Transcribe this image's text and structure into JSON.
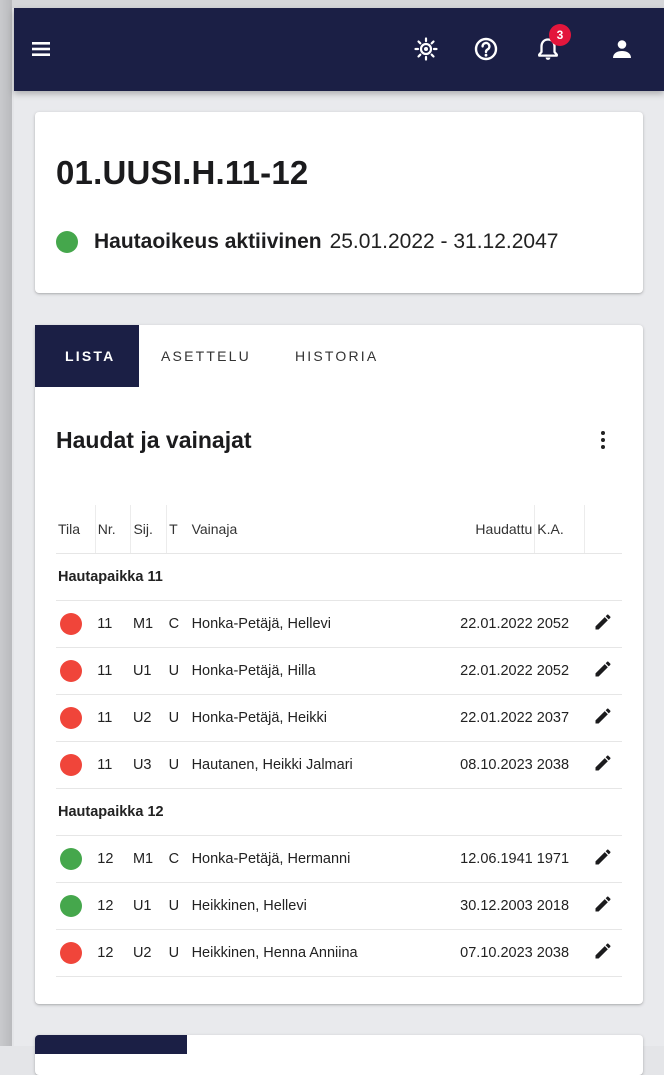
{
  "header": {
    "notification_count": "3",
    "icons": [
      "menu-icon",
      "sun-icon",
      "help-icon",
      "bell-icon",
      "user-icon"
    ]
  },
  "plot": {
    "id": "01.UUSI.H.11-12",
    "status_label": "Hautaoikeus aktiivinen",
    "status_dates": "25.01.2022 - 31.12.2047",
    "status_color": "#45a74c"
  },
  "tabs": [
    {
      "label": "LISTA",
      "active": true
    },
    {
      "label": "ASETTELU",
      "active": false
    },
    {
      "label": "HISTORIA",
      "active": false
    }
  ],
  "section": {
    "title": "Haudat ja vainajat"
  },
  "table": {
    "columns": [
      "Tila",
      "Nr.",
      "Sij.",
      "T",
      "Vainaja",
      "Haudattu",
      "K.A."
    ],
    "groups": [
      {
        "name": "Hautapaikka 11",
        "rows": [
          {
            "status": "red",
            "nr": "11",
            "sij": "M1",
            "t": "C",
            "name": "Honka-Petäjä, Hellevi",
            "date": "22.01.2022",
            "ka": "2052"
          },
          {
            "status": "red",
            "nr": "11",
            "sij": "U1",
            "t": "U",
            "name": "Honka-Petäjä, Hilla",
            "date": "22.01.2022",
            "ka": "2052"
          },
          {
            "status": "red",
            "nr": "11",
            "sij": "U2",
            "t": "U",
            "name": "Honka-Petäjä, Heikki",
            "date": "22.01.2022",
            "ka": "2037"
          },
          {
            "status": "red",
            "nr": "11",
            "sij": "U3",
            "t": "U",
            "name": "Hautanen, Heikki Jalmari",
            "date": "08.10.2023",
            "ka": "2038"
          }
        ]
      },
      {
        "name": "Hautapaikka 12",
        "rows": [
          {
            "status": "green",
            "nr": "12",
            "sij": "M1",
            "t": "C",
            "name": "Honka-Petäjä, Hermanni",
            "date": "12.06.1941",
            "ka": "1971"
          },
          {
            "status": "green",
            "nr": "12",
            "sij": "U1",
            "t": "U",
            "name": "Heikkinen, Hellevi",
            "date": "30.12.2003",
            "ka": "2018"
          },
          {
            "status": "red",
            "nr": "12",
            "sij": "U2",
            "t": "U",
            "name": "Heikkinen, Henna Anniina",
            "date": "07.10.2023",
            "ka": "2038"
          }
        ]
      }
    ]
  },
  "colors": {
    "primary": "#1b1f45",
    "red": "#f0453a",
    "green": "#45a74c",
    "badge": "#e3163c"
  }
}
